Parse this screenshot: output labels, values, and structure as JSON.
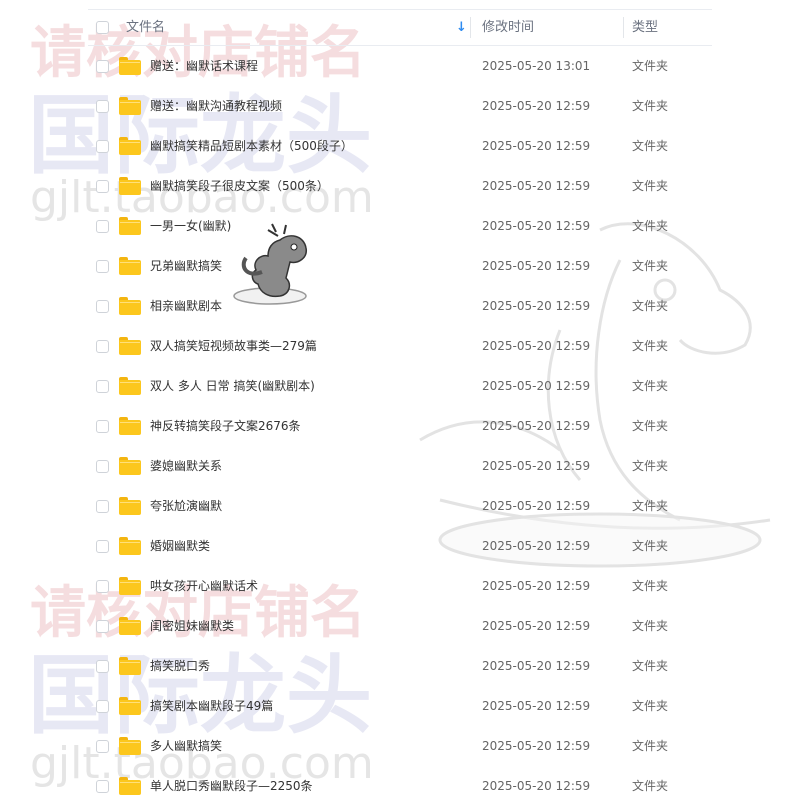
{
  "columns": {
    "name": "文件名",
    "modified": "修改时间",
    "type": "类型"
  },
  "sort_indicator": "↓",
  "watermark": {
    "line1": "请核对店铺名",
    "line2": "国际龙头",
    "url": "gjlt.taobao.com"
  },
  "files": [
    {
      "name": "赠送：幽默话术课程",
      "modified": "2025-05-20 13:01",
      "type": "文件夹"
    },
    {
      "name": "赠送：幽默沟通教程视频",
      "modified": "2025-05-20 12:59",
      "type": "文件夹"
    },
    {
      "name": "幽默搞笑精品短剧本素材（500段子）",
      "modified": "2025-05-20 12:59",
      "type": "文件夹"
    },
    {
      "name": "幽默搞笑段子很皮文案（500条）",
      "modified": "2025-05-20 12:59",
      "type": "文件夹"
    },
    {
      "name": "一男一女(幽默)",
      "modified": "2025-05-20 12:59",
      "type": "文件夹"
    },
    {
      "name": "兄弟幽默搞笑",
      "modified": "2025-05-20 12:59",
      "type": "文件夹"
    },
    {
      "name": "相亲幽默剧本",
      "modified": "2025-05-20 12:59",
      "type": "文件夹"
    },
    {
      "name": "双人搞笑短视频故事类—279篇",
      "modified": "2025-05-20 12:59",
      "type": "文件夹"
    },
    {
      "name": "双人 多人 日常 搞笑(幽默剧本)",
      "modified": "2025-05-20 12:59",
      "type": "文件夹"
    },
    {
      "name": "神反转搞笑段子文案2676条",
      "modified": "2025-05-20 12:59",
      "type": "文件夹"
    },
    {
      "name": "婆媳幽默关系",
      "modified": "2025-05-20 12:59",
      "type": "文件夹"
    },
    {
      "name": "夸张尬演幽默",
      "modified": "2025-05-20 12:59",
      "type": "文件夹"
    },
    {
      "name": "婚姻幽默类",
      "modified": "2025-05-20 12:59",
      "type": "文件夹"
    },
    {
      "name": "哄女孩开心幽默话术",
      "modified": "2025-05-20 12:59",
      "type": "文件夹"
    },
    {
      "name": "闺密姐妹幽默类",
      "modified": "2025-05-20 12:59",
      "type": "文件夹"
    },
    {
      "name": "搞笑脱口秀",
      "modified": "2025-05-20 12:59",
      "type": "文件夹"
    },
    {
      "name": "搞笑剧本幽默段子49篇",
      "modified": "2025-05-20 12:59",
      "type": "文件夹"
    },
    {
      "name": "多人幽默搞笑",
      "modified": "2025-05-20 12:59",
      "type": "文件夹"
    },
    {
      "name": "单人脱口秀幽默段子—2250条",
      "modified": "2025-05-20 12:59",
      "type": "文件夹"
    }
  ]
}
